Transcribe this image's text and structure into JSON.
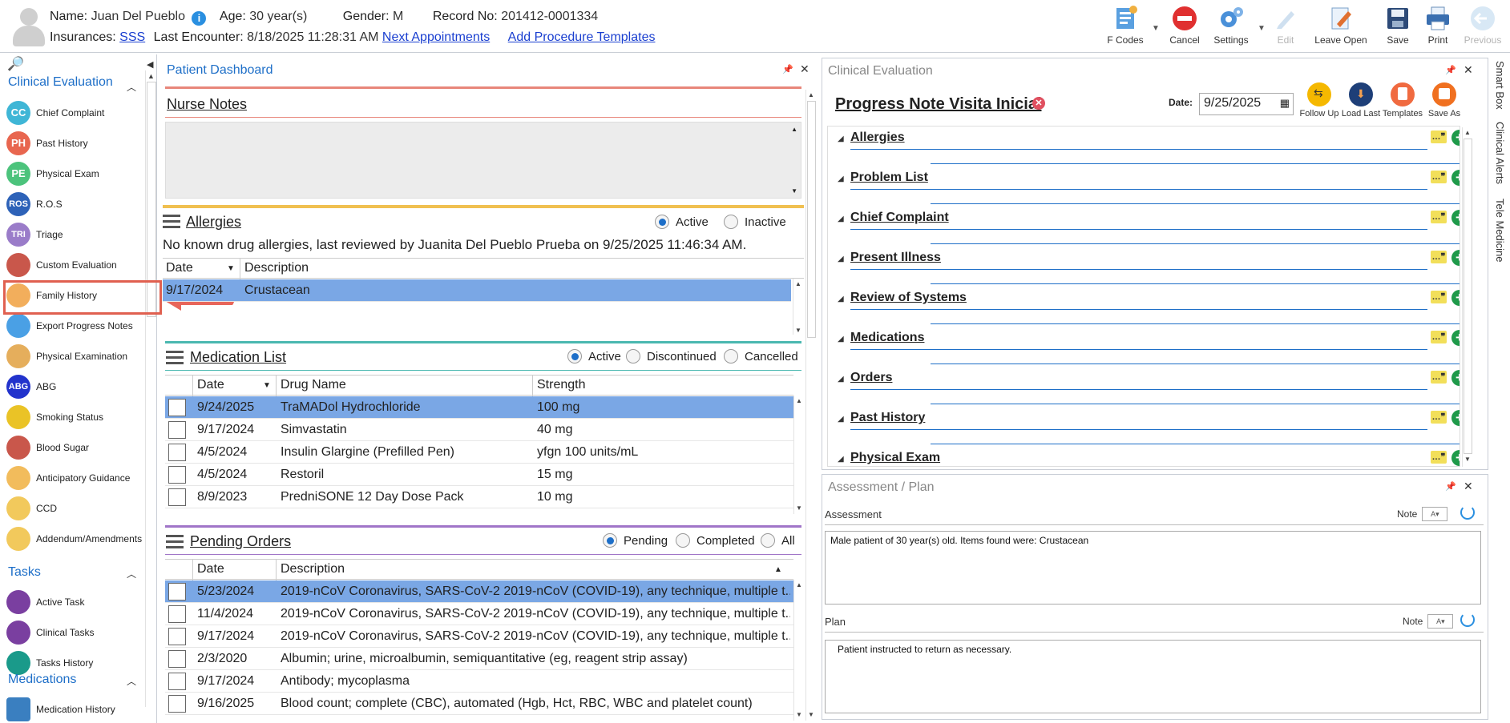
{
  "patient": {
    "name_label": "Name:",
    "name": "Juan Del Pueblo",
    "age_label": "Age:",
    "age": "30 year(s)",
    "gender_label": "Gender:",
    "gender": "M",
    "record_label": "Record No:",
    "record": "201412-0001334",
    "insurances_label": "Insurances:",
    "insurance": "SSS",
    "last_encounter_label": "Last Encounter:",
    "last_encounter": "8/18/2025 11:28:31 AM",
    "next_appointments": "Next Appointments",
    "add_procedure_templates": "Add Procedure Templates"
  },
  "toolbar": {
    "fcodes": "F Codes",
    "cancel": "Cancel",
    "settings": "Settings",
    "edit": "Edit",
    "leave_open": "Leave Open",
    "save": "Save",
    "print": "Print",
    "previous": "Previous"
  },
  "sidebar": {
    "clinical_evaluation": "Clinical Evaluation",
    "tasks": "Tasks",
    "medications": "Medications",
    "items": [
      {
        "label": "Chief Complaint",
        "abbr": "CC",
        "color": "#3fb6d6"
      },
      {
        "label": "Past History",
        "abbr": "PH",
        "color": "#e8664f"
      },
      {
        "label": "Physical Exam",
        "abbr": "PE",
        "color": "#4cc37c"
      },
      {
        "label": "R.O.S",
        "abbr": "ROS",
        "color": "#2d62b8"
      },
      {
        "label": "Triage",
        "abbr": "TRI",
        "color": "#9a7cc9"
      },
      {
        "label": "Custom Evaluation",
        "icon": "stethoscope-icon",
        "color": "#c0392b"
      },
      {
        "label": "Family History",
        "icon": "family-icon",
        "color": "#f0a040"
      },
      {
        "label": "Export Progress Notes",
        "icon": "export-icon",
        "color": "#2a8fe0"
      },
      {
        "label": "Physical Examination",
        "icon": "clipboard-icon",
        "color": "#e0a040"
      },
      {
        "label": "ABG",
        "abbr": "ABG",
        "color": "#2233cc"
      },
      {
        "label": "Smoking Status",
        "icon": "no-smoking-icon",
        "color": "#e6b800"
      },
      {
        "label": "Blood Sugar",
        "icon": "blood-drop-icon",
        "color": "#c0392b"
      },
      {
        "label": "Anticipatory Guidance",
        "icon": "guidance-icon",
        "color": "#f0b040"
      },
      {
        "label": "CCD",
        "icon": "ccd-icon",
        "color": "#f0c040"
      },
      {
        "label": "Addendum/Amendments",
        "icon": "addendum-icon",
        "color": "#f0c040"
      }
    ],
    "task_items": [
      {
        "label": "Active Task",
        "color": "#7a3fa0"
      },
      {
        "label": "Clinical Tasks",
        "color": "#7a3fa0"
      },
      {
        "label": "Tasks History",
        "color": "#1a9a8a"
      }
    ],
    "medication_items": [
      {
        "label": "Medication History",
        "color": "#3a7fc0"
      }
    ]
  },
  "dashboard": {
    "title": "Patient Dashboard",
    "nurse_notes": "Nurse Notes",
    "allergies": {
      "title": "Allergies",
      "active": "Active",
      "inactive": "Inactive",
      "summary": "No known drug allergies, last reviewed by Juanita Del Pueblo Prueba on 9/25/2025 11:46:34 AM.",
      "col_date": "Date",
      "col_desc": "Description",
      "rows": [
        {
          "date": "9/17/2024",
          "desc": "Crustacean"
        }
      ]
    },
    "medications": {
      "title": "Medication List",
      "active": "Active",
      "discontinued": "Discontinued",
      "cancelled": "Cancelled",
      "col_date": "Date",
      "col_drug": "Drug Name",
      "col_strength": "Strength",
      "rows": [
        {
          "date": "9/24/2025",
          "drug": "TraMADol Hydrochloride",
          "strength": "100 mg"
        },
        {
          "date": "9/17/2024",
          "drug": "Simvastatin",
          "strength": "40 mg"
        },
        {
          "date": "4/5/2024",
          "drug": "Insulin Glargine (Prefilled Pen)",
          "strength": "yfgn 100 units/mL"
        },
        {
          "date": "4/5/2024",
          "drug": "Restoril",
          "strength": "15 mg"
        },
        {
          "date": "8/9/2023",
          "drug": "PredniSONE 12 Day Dose Pack",
          "strength": "10 mg"
        }
      ]
    },
    "orders": {
      "title": "Pending Orders",
      "pending": "Pending",
      "completed": "Completed",
      "all": "All",
      "col_date": "Date",
      "col_desc": "Description",
      "rows": [
        {
          "date": "5/23/2024",
          "desc": "2019-nCoV Coronavirus, SARS-CoV-2 2019-nCoV (COVID-19), any technique, multiple t..."
        },
        {
          "date": "11/4/2024",
          "desc": "2019-nCoV Coronavirus, SARS-CoV-2 2019-nCoV (COVID-19), any technique, multiple t..."
        },
        {
          "date": "9/17/2024",
          "desc": "2019-nCoV Coronavirus, SARS-CoV-2 2019-nCoV (COVID-19), any technique, multiple t..."
        },
        {
          "date": "2/3/2020",
          "desc": "Albumin; urine, microalbumin, semiquantitative (eg, reagent strip assay)"
        },
        {
          "date": "9/17/2024",
          "desc": "Antibody; mycoplasma"
        },
        {
          "date": "9/16/2025",
          "desc": "Blood count; complete (CBC), automated (Hgb, Hct, RBC, WBC and platelet count)"
        }
      ]
    }
  },
  "clinical": {
    "title": "Clinical Evaluation",
    "note_title": "Progress Note Visita Inicial",
    "date_label": "Date:",
    "date": "9/25/2025",
    "follow_up": "Follow Up",
    "load_last": "Load Last",
    "templates": "Templates",
    "save_as": "Save As",
    "sections": [
      "Allergies",
      "Problem List",
      "Chief Complaint",
      "Present Illness",
      "Review of Systems",
      "Medications",
      "Orders",
      "Past History",
      "Physical Exam"
    ]
  },
  "assessment": {
    "title": "Assessment / Plan",
    "assessment_label": "Assessment",
    "assessment_text": "Male patient of 30 year(s) old. Items found were:  Crustacean",
    "plan_label": "Plan",
    "plan_text": "Patient instructed to return as necessary.",
    "note_label": "Note"
  },
  "side_strip": {
    "smart_box": "Smart Box",
    "clinical_alerts": "Clinical Alerts",
    "tele_medicine": "Tele Medicine"
  }
}
